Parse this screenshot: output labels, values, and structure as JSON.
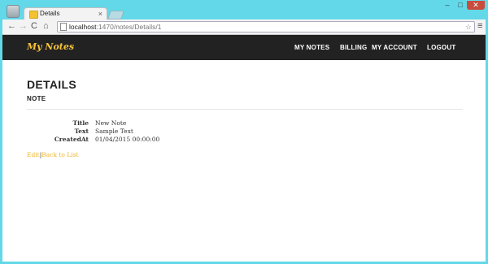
{
  "browser": {
    "tab_title": "Details",
    "tab_close": "×",
    "url_host": "localhost",
    "url_path": ":1470/notes/Details/1",
    "nav_back": "←",
    "nav_forward": "→",
    "nav_reload": "C",
    "nav_home": "⌂",
    "star": "☆",
    "menu": "≡",
    "win_min": "–",
    "win_max": "□",
    "win_close": "✕"
  },
  "navbar": {
    "brand": "My Notes",
    "links": [
      "MY NOTES",
      "BILLING",
      "MY ACCOUNT",
      "LOGOUT"
    ]
  },
  "page": {
    "title": "DETAILS",
    "subtitle": "NOTE",
    "fields": [
      {
        "label": "Title",
        "value": "New Note"
      },
      {
        "label": "Text",
        "value": "Sample Text"
      },
      {
        "label": "CreatedAt",
        "value": "01/04/2015 00:00:00"
      }
    ],
    "edit_link": "Edit",
    "separator": "|",
    "back_link": "Back to List"
  },
  "colors": {
    "navbar_bg": "#222222",
    "brand": "#f6c23a",
    "link": "#f0b429",
    "chrome_frame": "#63d8e8"
  }
}
